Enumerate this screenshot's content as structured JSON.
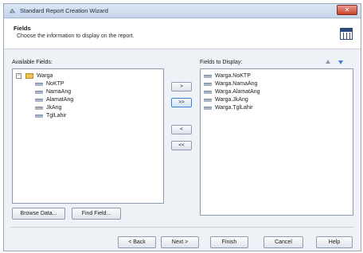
{
  "window": {
    "title": "Standard Report Creation Wizard",
    "close_glyph": "✕"
  },
  "header": {
    "title": "Fields",
    "subtitle": "Choose the information to display on the report.",
    "icon": "report-table-icon"
  },
  "available": {
    "label": "Available Fields:",
    "table_name": "Warga",
    "expander_glyph": "−",
    "fields": [
      "NoKTP",
      "NamaAng",
      "AlamatAng",
      "JkAng",
      "TglLahir"
    ]
  },
  "display": {
    "label": "Fields to Display:",
    "fields": [
      "Warga.NoKTP",
      "Warga.NamaAng",
      "Warga.AlamatAng",
      "Warga.JkAng",
      "Warga.TglLahir"
    ],
    "up_icon": "arrow-up-icon",
    "down_icon": "arrow-down-icon"
  },
  "move": {
    "add_one": ">",
    "add_all": ">>",
    "remove_one": "<",
    "remove_all": "<<"
  },
  "actions": {
    "browse": "Browse Data...",
    "find": "Find Field..."
  },
  "footer": {
    "back": "< Back",
    "next": "Next >",
    "finish": "Finish",
    "cancel": "Cancel",
    "help": "Help"
  },
  "colors": {
    "accent": "#3c7fd4",
    "close": "#c8442e",
    "folder": "#e8c45a"
  }
}
